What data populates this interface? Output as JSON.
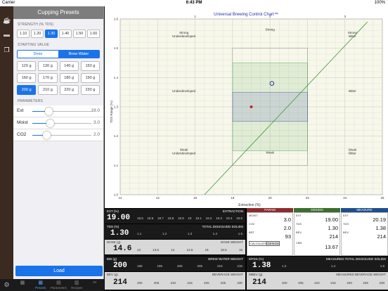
{
  "status": {
    "carrier": "Carrier",
    "time": "6:43 PM",
    "battery": "100%"
  },
  "panel": {
    "title": "Cupping Presets",
    "strength_label": "STRENGTH (% TDS)",
    "strength": [
      "1.10",
      "1.20",
      "1.30",
      "1.40",
      "1.50",
      "1.60"
    ],
    "starting_label": "STARTING VALUE",
    "dose_label": "Dose",
    "brew_water_label": "Brew Water",
    "values": [
      "120 g",
      "130 g",
      "140 g",
      "150 g",
      "160 g",
      "170 g",
      "180 g",
      "190 g",
      "200 g",
      "210 g",
      "220 g",
      "230 g"
    ],
    "params_label": "PARAMETERS",
    "params": [
      {
        "name": "Ext",
        "value": "19.0"
      },
      {
        "name": "Moist",
        "value": "3.0"
      },
      {
        "name": "CO2",
        "value": "2.0"
      }
    ],
    "load": "Load"
  },
  "tabs": [
    "Presets",
    "Parameters",
    "Recipes"
  ],
  "chart_data": {
    "type": "scatter",
    "title": "Universal Brewing Control Chart™",
    "xlabel": "Extraction (%)",
    "ylabel": "TDS Range (%)",
    "xlim": [
      12,
      26
    ],
    "ylim": [
      1.0,
      1.6
    ],
    "xticks": [
      "12",
      "14",
      "16",
      "18",
      "20",
      "22",
      "24",
      "26"
    ],
    "yticks": [
      "1.6",
      "1.5",
      "1.4",
      "1.3",
      "1.2",
      "1.1",
      "1.0"
    ],
    "top_labels": [
      "1",
      "2",
      "3"
    ],
    "regions": [
      "Strong Underdeveloped",
      "Strong",
      "Strong Bitter",
      "Underdeveloped",
      "Bitter",
      "Weak Underdeveloped",
      "Weak",
      "Weak Bitter"
    ],
    "brew_ratio_line": [
      [
        16.5,
        1.0
      ],
      [
        25.2,
        1.59
      ]
    ],
    "points": [
      {
        "x": 19.0,
        "y": 1.3,
        "color": "#cc2222"
      },
      {
        "x": 20.1,
        "y": 1.38,
        "color": "#2233aa"
      }
    ]
  },
  "instruments": {
    "ext": {
      "label": "EXT (%)",
      "title": "EXTRACTION",
      "value": "19.00",
      "scale": [
        "18.5",
        "18.6",
        "18.7",
        "18.8",
        "18.9",
        "19",
        "19.1",
        "19.2",
        "19.3",
        "19.4",
        "19.5"
      ]
    },
    "tds": {
      "label": "TDS (%)",
      "title": "TOTAL DISSOLVED SOLIDS",
      "value": "1.30",
      "scale": [
        "1.1",
        "1.2",
        "1.3",
        "1.4",
        "1.5"
      ]
    },
    "dose": {
      "label": "DOSE (g)",
      "title": "DOSE WEIGHT",
      "value": "14.6",
      "scale": [
        "13",
        "13.5",
        "14",
        "14.5",
        "15",
        "15.5",
        "16"
      ]
    },
    "bw": {
      "label": "BW (g)",
      "title": "BREW WATER WEIGHT",
      "value": "200",
      "scale": [
        "190",
        "195",
        "200",
        "205",
        "210",
        "215"
      ]
    },
    "bev": {
      "label": "BEV (g)",
      "title": "BEVERAGE WEIGHT",
      "value": "214",
      "scale": [
        "200",
        "205",
        "210",
        "215",
        "220",
        "225",
        "230"
      ]
    },
    "mtds": {
      "label": "MTDS (%)",
      "title": "MEASURED TOTAL DISSOLVED SOLIDS",
      "value": "1.38",
      "scale": [
        "1.3",
        "1.4",
        "1.5"
      ]
    },
    "mbev": {
      "label": "MBEV (g)",
      "title": "MEASURED BEVERAGE WEIGHT",
      "value": "214",
      "scale": [
        "200",
        "205",
        "210",
        "215",
        "220",
        "225",
        "230"
      ]
    }
  },
  "table": {
    "headers": [
      "PARAM",
      "DESIGN",
      "MEASURE"
    ],
    "moist_l": "MOIST",
    "moist_v": "3.0",
    "co2_l": "CO2",
    "co2_v": "2.0",
    "brt_l": "BRT",
    "brt_v": "93",
    "ext_l": "EXT",
    "ext_d": "19.00",
    "ext_m": "20.19",
    "tds_l": "TDS",
    "tds_d": "1.30",
    "tds_m": "1.38",
    "bev_l": "BEV",
    "bev_d": "214",
    "bev_m": "214",
    "cbr_l": "CBR",
    "cbr_d": "13.67",
    "calc": "CALCULATE",
    "design": "DESIGN"
  },
  "colors": {
    "accent": "#1a73e8",
    "param": "#8b2d2d",
    "design": "#3b6e2f",
    "measure": "#1f4e8c"
  }
}
